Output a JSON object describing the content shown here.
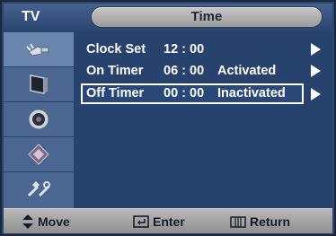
{
  "header": {
    "source_label": "TV",
    "menu_title": "Time"
  },
  "sidebar": {
    "items": [
      {
        "icon": "antenna-plug-icon"
      },
      {
        "icon": "picture-monitor-icon"
      },
      {
        "icon": "speaker-sound-icon"
      },
      {
        "icon": "channel-icon"
      },
      {
        "icon": "setup-tools-icon"
      }
    ],
    "active_index": 0
  },
  "menu": {
    "rows": [
      {
        "label": "Clock Set",
        "value": "12 : 00",
        "status": ""
      },
      {
        "label": "On Timer",
        "value": "06 : 00",
        "status": "Activated"
      },
      {
        "label": "Off Timer",
        "value": "00 : 00",
        "status": "Inactivated"
      }
    ],
    "selected_index": 2
  },
  "footer": {
    "move_label": "Move",
    "enter_label": "Enter",
    "return_label": "Return"
  },
  "colors": {
    "panel": "#27426d",
    "sidebar": "#4a6691",
    "footer": "#a6a6a6",
    "text": "#ffffff"
  }
}
